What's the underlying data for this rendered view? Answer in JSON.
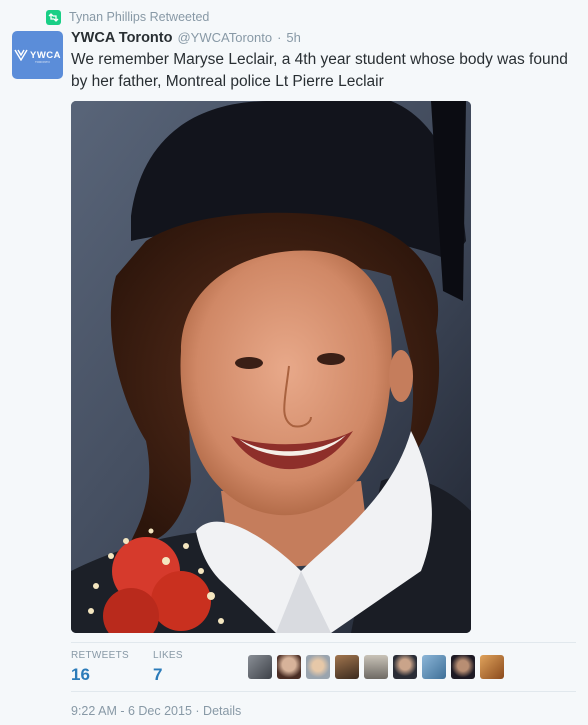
{
  "retweet_context": {
    "icon": "retweet-icon",
    "text": "Tynan Phillips Retweeted"
  },
  "author": {
    "avatar_text": "YWCA",
    "avatar_subtext": "TORONTO",
    "avatar_color": "#5b8dd9",
    "name": "YWCA Toronto",
    "handle": "@YWCAToronto",
    "separator": "·",
    "time": "5h"
  },
  "tweet": {
    "text": "We remember Maryse Leclair, a 4th year student whose body was found by her father, Montreal police Lt Pierre Leclair"
  },
  "stats": {
    "retweets_label": "RETWEETS",
    "retweets_count": "16",
    "likes_label": "LIKES",
    "likes_count": "7"
  },
  "likers": [
    {
      "name": "liker-avatar-1"
    },
    {
      "name": "liker-avatar-2"
    },
    {
      "name": "liker-avatar-3"
    },
    {
      "name": "liker-avatar-4"
    },
    {
      "name": "liker-avatar-5"
    },
    {
      "name": "liker-avatar-6"
    },
    {
      "name": "liker-avatar-7"
    },
    {
      "name": "liker-avatar-8"
    },
    {
      "name": "liker-avatar-9"
    }
  ],
  "footer": {
    "timestamp": "9:22 AM - 6 Dec 2015",
    "separator": "·",
    "details_label": "Details"
  },
  "colors": {
    "link": "#2b7bb9",
    "muted": "#8899a6",
    "retweet_green": "#19cf86",
    "background": "#f5f8fa"
  }
}
